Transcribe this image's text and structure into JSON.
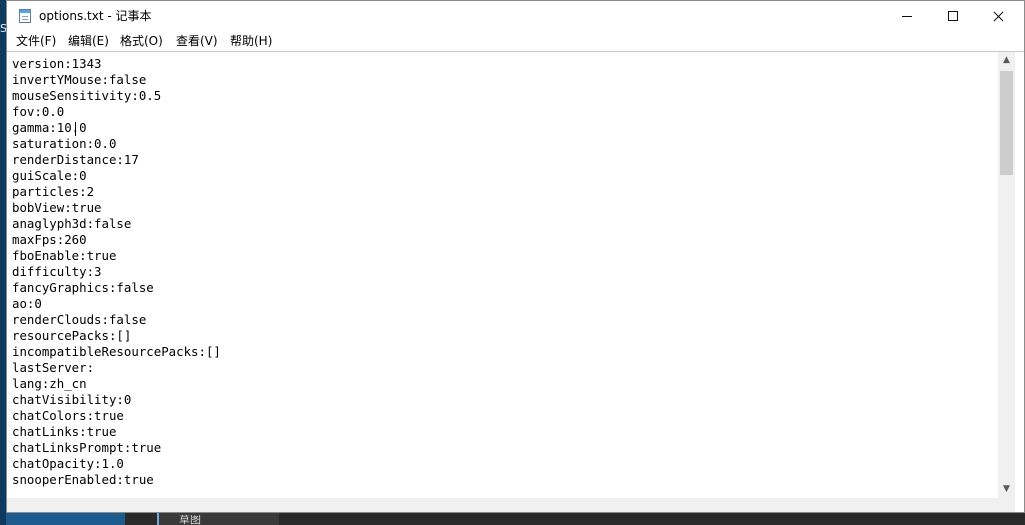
{
  "window": {
    "title": "options.txt - 记事本"
  },
  "menu": {
    "items": [
      "文件(F)",
      "编辑(E)",
      "格式(O)",
      "查看(V)",
      "帮助(H)"
    ]
  },
  "editor": {
    "lines": [
      "version:1343",
      "invertYMouse:false",
      "mouseSensitivity:0.5",
      "fov:0.0",
      "gamma:10.0",
      "saturation:0.0",
      "renderDistance:17",
      "guiScale:0",
      "particles:2",
      "bobView:true",
      "anaglyph3d:false",
      "maxFps:260",
      "fboEnable:true",
      "difficulty:3",
      "fancyGraphics:false",
      "ao:0",
      "renderClouds:false",
      "resourcePacks:[]",
      "incompatibleResourcePacks:[]",
      "lastServer:",
      "lang:zh_cn",
      "chatVisibility:0",
      "chatColors:true",
      "chatLinks:true",
      "chatLinksPrompt:true",
      "chatOpacity:1.0",
      "snooperEnabled:true"
    ]
  },
  "desktop": {
    "edge_letter": "S",
    "taskbar_item": "草图"
  },
  "icons": {
    "app": "notepad-icon",
    "minimize": "minimize-icon",
    "maximize": "maximize-icon",
    "close": "close-icon",
    "scroll_up": "chevron-up-icon",
    "scroll_down": "chevron-down-icon"
  },
  "colors": {
    "desktop": "#1d5a8e",
    "window_bg": "#ffffff",
    "text": "#000000",
    "scrollbar_track": "#f0f0f0",
    "scrollbar_thumb": "#cdcdcd"
  }
}
